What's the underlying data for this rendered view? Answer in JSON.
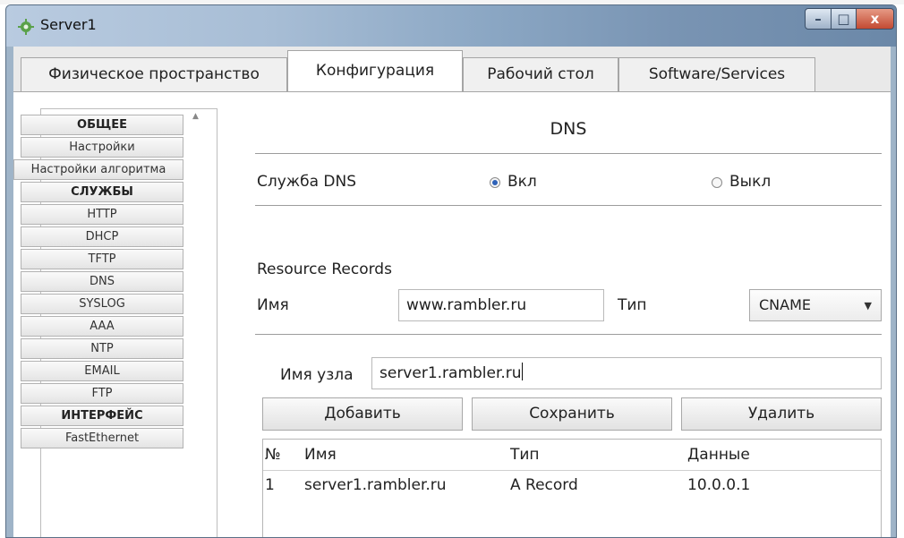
{
  "window": {
    "title": "Server1",
    "controls": {
      "minimize": "–",
      "maximize": "□",
      "close": "x"
    }
  },
  "tabs": [
    {
      "label": "Физическое пространство",
      "active": false
    },
    {
      "label": "Конфигурация",
      "active": true
    },
    {
      "label": "Рабочий стол",
      "active": false
    },
    {
      "label": "Software/Services",
      "active": false
    }
  ],
  "sidebar": {
    "items": [
      {
        "label": "ОБЩЕЕ",
        "kind": "header"
      },
      {
        "label": "Настройки",
        "kind": "item"
      },
      {
        "label": "Настройки алгоритма",
        "kind": "item"
      },
      {
        "label": "СЛУЖБЫ",
        "kind": "header"
      },
      {
        "label": "HTTP",
        "kind": "item"
      },
      {
        "label": "DHCP",
        "kind": "item"
      },
      {
        "label": "TFTP",
        "kind": "item"
      },
      {
        "label": "DNS",
        "kind": "item"
      },
      {
        "label": "SYSLOG",
        "kind": "item"
      },
      {
        "label": "AAA",
        "kind": "item"
      },
      {
        "label": "NTP",
        "kind": "item"
      },
      {
        "label": "EMAIL",
        "kind": "item"
      },
      {
        "label": "FTP",
        "kind": "item"
      },
      {
        "label": "ИНТЕРФЕЙС",
        "kind": "header"
      },
      {
        "label": "FastEthernet",
        "kind": "item"
      }
    ]
  },
  "dns": {
    "title": "DNS",
    "service_label": "Служба DNS",
    "on_label": "Вкл",
    "off_label": "Выкл",
    "service_on": true,
    "records_heading": "Resource Records",
    "name_label": "Имя",
    "name_value": "www.rambler.ru",
    "type_label": "Тип",
    "type_value": "CNAME",
    "host_label": "Имя узла",
    "host_value": "server1.rambler.ru",
    "buttons": {
      "add": "Добавить",
      "save": "Сохранить",
      "delete": "Удалить"
    },
    "table": {
      "headers": [
        "№",
        "Имя",
        "Тип",
        "Данные"
      ],
      "rows": [
        [
          "1",
          "server1.rambler.ru",
          "A Record",
          "10.0.0.1"
        ]
      ]
    }
  },
  "colors": {
    "radio_on": "#2e62b8",
    "close_button": "#c34a32"
  },
  "icons": {
    "app": "server-gear-icon",
    "dropdown": "chevron-down-icon"
  }
}
